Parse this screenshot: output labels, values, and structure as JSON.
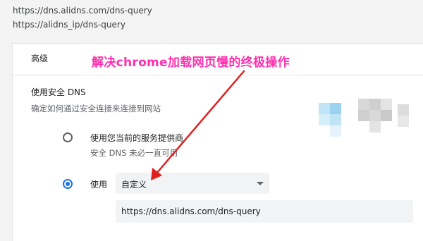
{
  "urls": [
    "https://dns.alidns.com/dns-query",
    "https://alidns_ip/dns-query"
  ],
  "settings": {
    "section_header": "高级",
    "secure_dns": {
      "title": "使用安全 DNS",
      "description": "确定如何通过安全连接来连接到网站",
      "option_provider": {
        "label": "使用您当前的服务提供商",
        "sublabel": "安全 DNS 未必一直可用",
        "selected": false
      },
      "option_custom": {
        "label": "使用",
        "dropdown_value": "自定义",
        "selected": true
      },
      "custom_url": "https://dns.alidns.com/dns-query"
    }
  },
  "annotation": {
    "text": "解决chrome加载网页慢的终极操作",
    "color": "#ff2fae",
    "arrow_color": "#e02020"
  },
  "colors": {
    "accent": "#1a73e8",
    "pixelated_tiles": [
      "#bfe4f5",
      "#d8d8d8",
      "#cfcfcf",
      "#9ad3f0",
      "#e4e4e4"
    ]
  }
}
